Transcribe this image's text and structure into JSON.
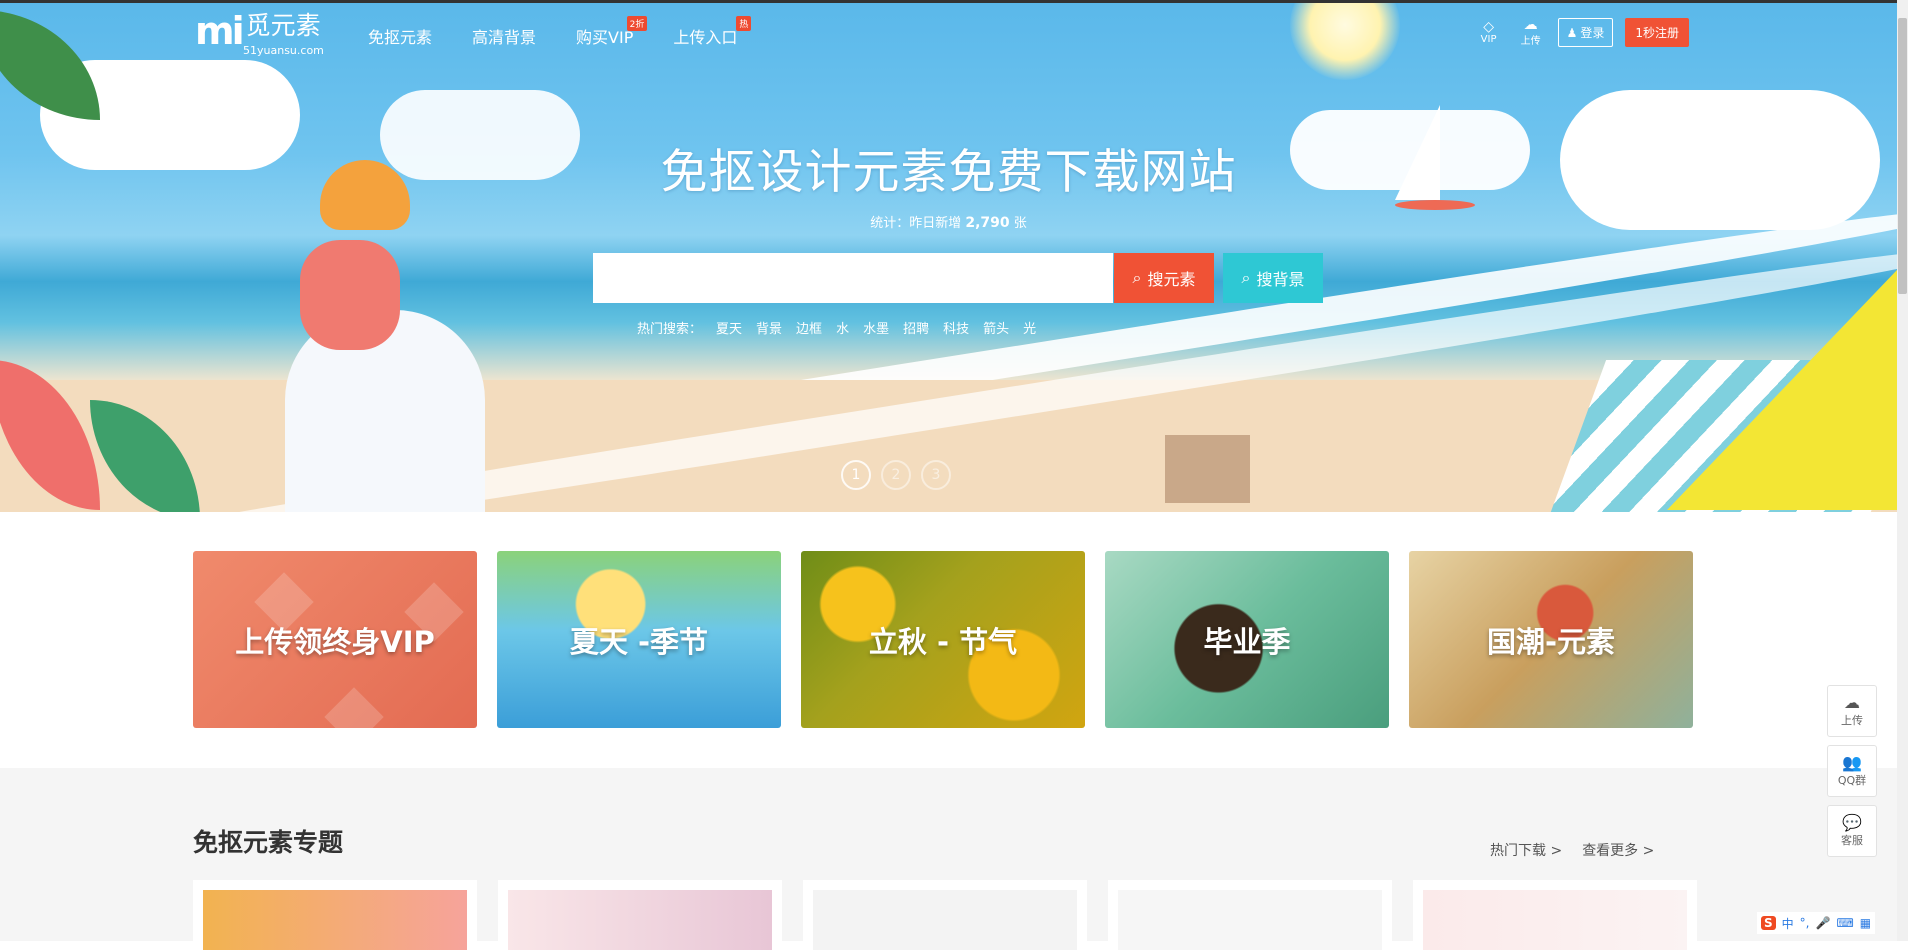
{
  "nav": {
    "logo_mark": "mi",
    "logo_text": "觅元素",
    "logo_domain": "51yuansu.com",
    "links": [
      {
        "label": "免抠元素",
        "badge": ""
      },
      {
        "label": "高清背景",
        "badge": ""
      },
      {
        "label": "购买VIP",
        "badge": "2折"
      },
      {
        "label": "上传入口",
        "badge": "热"
      }
    ],
    "vip_label": "VIP",
    "upload_label": "上传",
    "login_label": "登录",
    "register_label": "1秒注册"
  },
  "hero": {
    "headline": "免抠设计元素免费下载网站",
    "stats_prefix": "统计：昨日新增",
    "stats_count": "2,790",
    "stats_unit": "张",
    "search_placeholder": "",
    "search_elements_label": "搜元素",
    "search_backgrounds_label": "搜背景",
    "hot_label": "热门搜索：",
    "hot_keywords": [
      "夏天",
      "背景",
      "边框",
      "水",
      "水墨",
      "招聘",
      "科技",
      "箭头",
      "光"
    ],
    "slides": [
      "1",
      "2",
      "3"
    ],
    "active_slide": 1
  },
  "categories": [
    {
      "label": "上传领终身VIP"
    },
    {
      "label": "夏天 -季节"
    },
    {
      "label": "立秋 - 节气"
    },
    {
      "label": "毕业季"
    },
    {
      "label": "国潮-元素"
    }
  ],
  "topics": {
    "title": "免抠元素专题",
    "hot_downloads": "热门下载 >",
    "see_more": "查看更多 >"
  },
  "float_bar": [
    {
      "label": "上传",
      "icon": "cloud-upload-icon"
    },
    {
      "label": "QQ群",
      "icon": "group-icon"
    },
    {
      "label": "客服",
      "icon": "chat-icon"
    }
  ],
  "ime": {
    "s": "S",
    "lang": "中"
  },
  "colors": {
    "accent_red": "#f05235",
    "accent_cyan": "#2ec8d4"
  }
}
